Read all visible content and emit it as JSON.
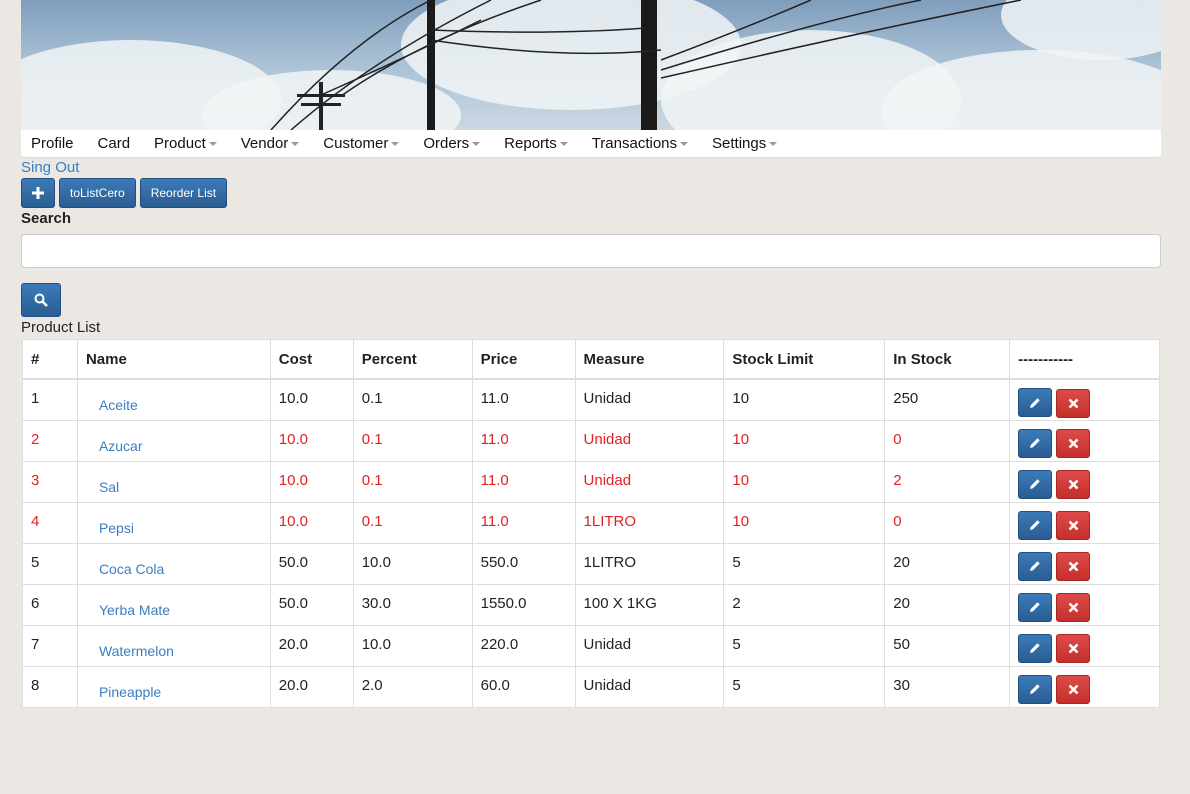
{
  "nav": {
    "items": [
      {
        "label": "Profile",
        "dropdown": false
      },
      {
        "label": "Card",
        "dropdown": false
      },
      {
        "label": "Product",
        "dropdown": true
      },
      {
        "label": "Vendor",
        "dropdown": true
      },
      {
        "label": "Customer",
        "dropdown": true
      },
      {
        "label": "Orders",
        "dropdown": true
      },
      {
        "label": "Reports",
        "dropdown": true
      },
      {
        "label": "Transactions",
        "dropdown": true
      },
      {
        "label": "Settings",
        "dropdown": true
      }
    ]
  },
  "signout_label": "Sing Out",
  "toolbar": {
    "add_icon": "plus-icon",
    "tolistcero_label": "toListCero",
    "reorder_label": "Reorder List"
  },
  "search": {
    "label": "Search",
    "value": "",
    "search_icon": "search-icon"
  },
  "product_list": {
    "title": "Product List",
    "columns": [
      "#",
      "Name",
      "Cost",
      "Percent",
      "Price",
      "Measure",
      "Stock Limit",
      "In Stock",
      "-----------"
    ],
    "rows": [
      {
        "num": "1",
        "name": "Aceite",
        "cost": "10.0",
        "percent": "0.1",
        "price": "11.0",
        "measure": "Unidad",
        "limit": "10",
        "stock": "250",
        "alert": false
      },
      {
        "num": "2",
        "name": "Azucar",
        "cost": "10.0",
        "percent": "0.1",
        "price": "11.0",
        "measure": "Unidad",
        "limit": "10",
        "stock": "0",
        "alert": true
      },
      {
        "num": "3",
        "name": "Sal",
        "cost": "10.0",
        "percent": "0.1",
        "price": "11.0",
        "measure": "Unidad",
        "limit": "10",
        "stock": "2",
        "alert": true
      },
      {
        "num": "4",
        "name": "Pepsi",
        "cost": "10.0",
        "percent": "0.1",
        "price": "11.0",
        "measure": "1LITRO",
        "limit": "10",
        "stock": "0",
        "alert": true
      },
      {
        "num": "5",
        "name": "Coca Cola",
        "cost": "50.0",
        "percent": "10.0",
        "price": "550.0",
        "measure": "1LITRO",
        "limit": "5",
        "stock": "20",
        "alert": false
      },
      {
        "num": "6",
        "name": "Yerba Mate",
        "cost": "50.0",
        "percent": "30.0",
        "price": "1550.0",
        "measure": "100 X 1KG",
        "limit": "2",
        "stock": "20",
        "alert": false
      },
      {
        "num": "7",
        "name": "Watermelon",
        "cost": "20.0",
        "percent": "10.0",
        "price": "220.0",
        "measure": "Unidad",
        "limit": "5",
        "stock": "50",
        "alert": false
      },
      {
        "num": "8",
        "name": "Pineapple",
        "cost": "20.0",
        "percent": "2.0",
        "price": "60.0",
        "measure": "Unidad",
        "limit": "5",
        "stock": "30",
        "alert": false
      }
    ]
  },
  "colors": {
    "link": "#3a7ec2",
    "alert": "#e02222",
    "primary": "#2f6aa3",
    "danger": "#d9383a"
  }
}
